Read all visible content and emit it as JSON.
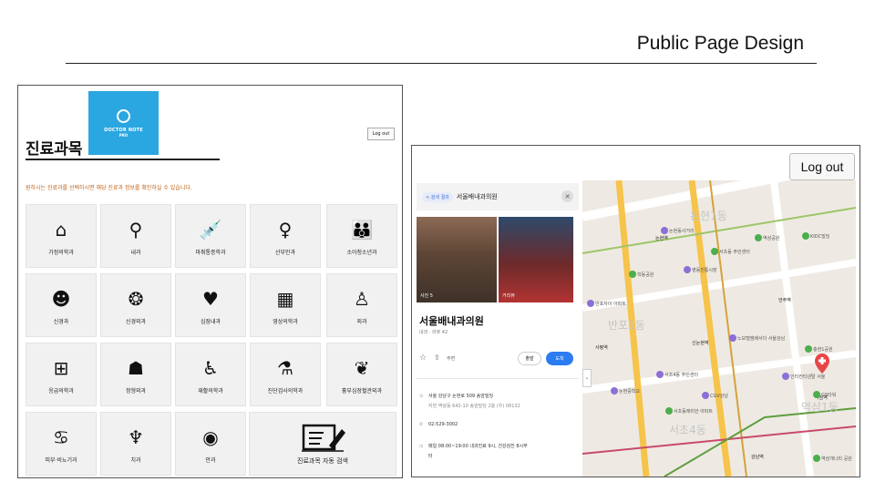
{
  "slide": {
    "title": "Public Page Design"
  },
  "left": {
    "heading": "진료과목",
    "logo": {
      "line1": "DOCTOR NOTE",
      "line2": "PRO"
    },
    "logout": "Log out",
    "instruction": "원하시는 진료과를 선택하시면 해당 진료과 정보를 확인하실 수 있습니다.",
    "departments": [
      {
        "label": "가정의학과",
        "icon": "home-heart-icon",
        "glyph": "⌂"
      },
      {
        "label": "내과",
        "icon": "doctor-magnifier-icon",
        "glyph": "⚲"
      },
      {
        "label": "마취통증학과",
        "icon": "syringe-icon",
        "glyph": "💉"
      },
      {
        "label": "산부인과",
        "icon": "uterus-icon",
        "glyph": "♀"
      },
      {
        "label": "소아청소년과",
        "icon": "parent-child-icon",
        "glyph": "👪"
      },
      {
        "label": "신경과",
        "icon": "head-brain-icon",
        "glyph": "☻"
      },
      {
        "label": "신경외과",
        "icon": "brain-icon",
        "glyph": "❂"
      },
      {
        "label": "심장내과",
        "icon": "heart-icon",
        "glyph": "♥"
      },
      {
        "label": "영상의학과",
        "icon": "xray-icon",
        "glyph": "▦"
      },
      {
        "label": "외과",
        "icon": "surgeon-icon",
        "glyph": "♙"
      },
      {
        "label": "응급의학과",
        "icon": "first-aid-kit-icon",
        "glyph": "⊞"
      },
      {
        "label": "정형외과",
        "icon": "bone-joint-icon",
        "glyph": "☗"
      },
      {
        "label": "재활의학과",
        "icon": "wheelchair-icon",
        "glyph": "♿"
      },
      {
        "label": "진단검사의학과",
        "icon": "microscope-icon",
        "glyph": "⚗"
      },
      {
        "label": "흉부심장혈관외과",
        "icon": "lungs-icon",
        "glyph": "❦"
      },
      {
        "label": "피부·비뇨기과",
        "icon": "kidney-icon",
        "glyph": "♋"
      },
      {
        "label": "치과",
        "icon": "tooth-icon",
        "glyph": "♆"
      },
      {
        "label": "안과",
        "icon": "eye-icon",
        "glyph": "◉"
      }
    ],
    "search_label": "진료과목 자동 검색"
  },
  "right": {
    "logout": "Log out",
    "card": {
      "back": "< 검색 결과",
      "clinic_top": "서울배내과의원",
      "photo_left_tag": "사진 5",
      "photo_right_tag": "거리뷰",
      "clinic_name": "서울배내과의원",
      "meta": "내과 · 리뷰 42",
      "save": "주변",
      "depart": "출발",
      "arrive": "도착",
      "address": "서울 강남구 논현로 509 송암빌딩",
      "address_sub": "지번 역삼동 642-10 송암빌딩 2층 (우) 06132",
      "phone": "02-529-3002",
      "hours": "매일 08:00~19:00 내과진료 9시, 건강검진 8시부",
      "hours_cont": "터"
    },
    "map": {
      "labels": [
        {
          "text": "논현1동",
          "kind": "district"
        },
        {
          "text": "반포1동",
          "kind": "district"
        },
        {
          "text": "역삼1동",
          "kind": "district"
        },
        {
          "text": "서초4동",
          "kind": "district"
        },
        {
          "text": "논현역",
          "kind": "station"
        },
        {
          "text": "신논현역",
          "kind": "station"
        },
        {
          "text": "언주역",
          "kind": "station"
        },
        {
          "text": "강남역",
          "kind": "station"
        },
        {
          "text": "역삼역",
          "kind": "station"
        },
        {
          "text": "KIDC빌딩",
          "kind": "poi"
        },
        {
          "text": "논현동사거리",
          "kind": "poi"
        },
        {
          "text": "학동공원",
          "kind": "poi"
        },
        {
          "text": "영동전통시장",
          "kind": "poi"
        },
        {
          "text": "서초동 주민센터",
          "kind": "poi"
        },
        {
          "text": "반포자이 아파트",
          "kind": "poi"
        },
        {
          "text": "사평역",
          "kind": "station"
        },
        {
          "text": "서초4동 주민센터",
          "kind": "poi"
        },
        {
          "text": "역삼공원",
          "kind": "poi"
        },
        {
          "text": "노보텔앰배서더 서울강남",
          "kind": "poi"
        },
        {
          "text": "충현1공원",
          "kind": "poi"
        },
        {
          "text": "인터컨티넨탈 서울",
          "kind": "poi"
        },
        {
          "text": "GS타워",
          "kind": "poi"
        },
        {
          "text": "CGV강남",
          "kind": "poi"
        },
        {
          "text": "서초동래미안 아파트",
          "kind": "poi"
        },
        {
          "text": "논현중학교",
          "kind": "poi"
        },
        {
          "text": "역삼개나리 공원",
          "kind": "poi"
        }
      ]
    }
  }
}
